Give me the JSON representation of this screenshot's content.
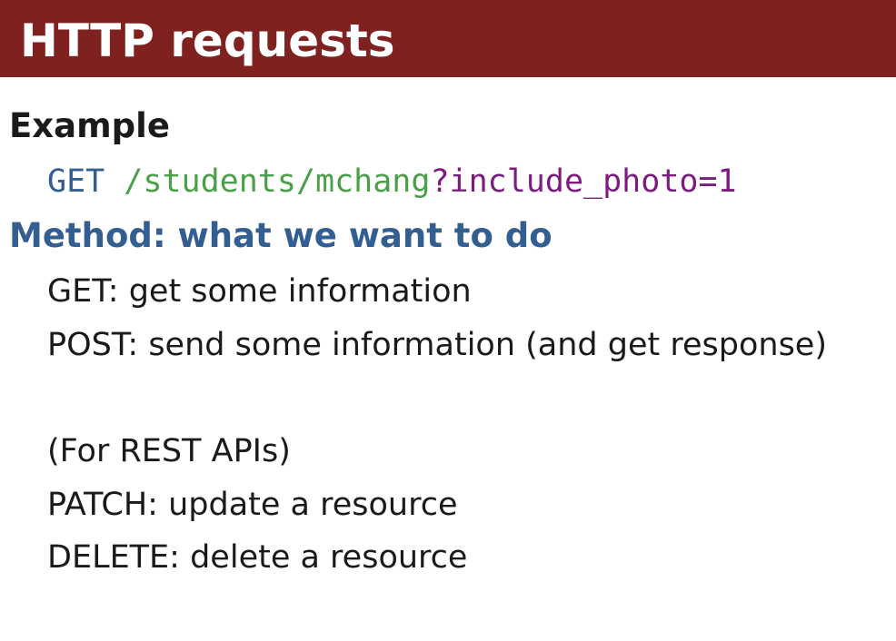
{
  "slide": {
    "title": "HTTP requests",
    "example_heading": "Example",
    "example_code": {
      "method": "GET",
      "path": "/students/mchang",
      "query": "?include_photo=1"
    },
    "method_heading": "Method: what we want to do",
    "method_lines": [
      "GET: get some information",
      "POST: send some information (and get response)",
      "(For REST APIs)",
      "PATCH: update a resource",
      "DELETE: delete a resource"
    ],
    "colors": {
      "title_bar": "#7f211f",
      "heading_blue": "#335e92",
      "code_path_green": "#4aa048",
      "code_query_purple": "#7b1d7e"
    }
  }
}
